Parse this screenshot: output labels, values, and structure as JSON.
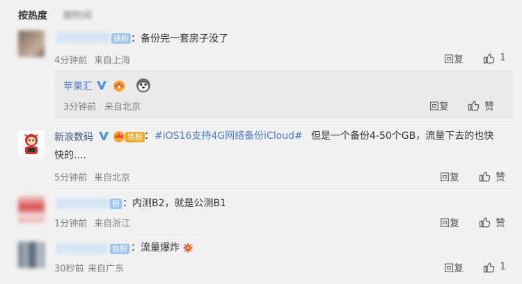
{
  "sort_tabs": [
    {
      "label": "按热度"
    },
    {
      "label": "按时间"
    }
  ],
  "comments": [
    {
      "badge": "铁粉",
      "text": "：备份完一套房子没了",
      "time": "4分钟前",
      "location": "来自上海",
      "reply_label": "回复",
      "like_count": "1"
    },
    {
      "username": "苹果汇",
      "time": "3分钟前",
      "location": "来自北京",
      "reply_label": "回复",
      "like_label": "赞"
    },
    {
      "username": "新浪数码",
      "badge": "铁粉",
      "topic": "#iOS16支持4G网络备份iCloud#",
      "text_part1": " 但是一个备份4-50个GB，流量下去的也快",
      "text_part2": "快的....",
      "time": "5分钟前",
      "location": "来自北京",
      "reply_label": "回复",
      "like_label": "赞"
    },
    {
      "badge": "粉",
      "text": "：内测B2，就是公测B1",
      "time": "1分钟前",
      "location": "来自浙江",
      "reply_label": "回复",
      "like_label": "赞"
    },
    {
      "badge": "铁粉",
      "text": "：流量爆炸",
      "time": "30秒前",
      "location": "来自广东",
      "reply_label": "回复",
      "like_count": "1"
    }
  ],
  "colors": {
    "background": "#f1f1f1",
    "link": "#4e7ed4",
    "username": "#33567f",
    "badge": "#7fb3ee",
    "verified": "#f5a623",
    "v_blue": "#4a90e2"
  },
  "icons": {
    "like": "thumbs-up-icon",
    "verified": "verified-v-icon",
    "explosion": "explosion-emoji"
  }
}
